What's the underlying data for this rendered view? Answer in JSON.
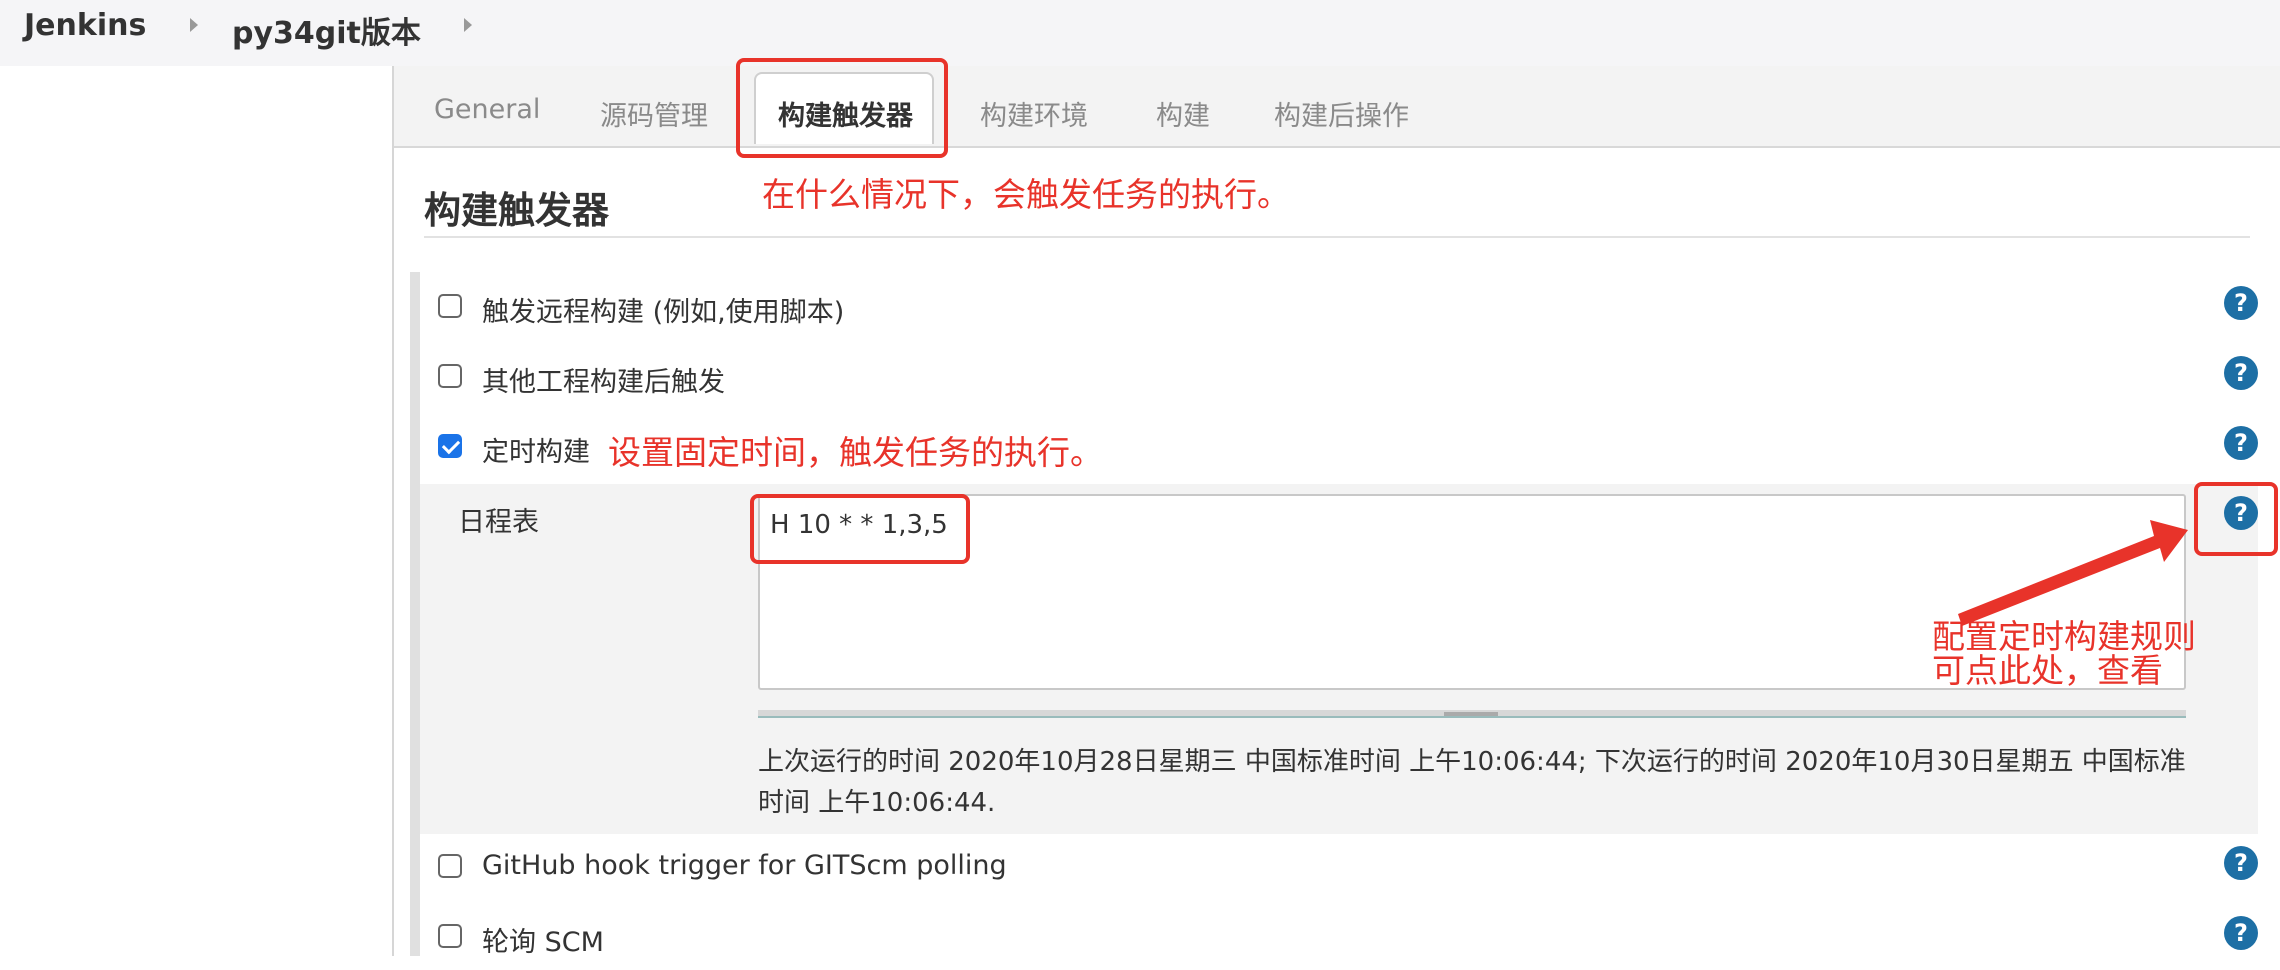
{
  "breadcrumb": {
    "root": "Jenkins",
    "job": "py34git版本"
  },
  "tabs": [
    "General",
    "源码管理",
    "构建触发器",
    "构建环境",
    "构建",
    "构建后操作"
  ],
  "active_tab": "构建触发器",
  "section_title": "构建触发器",
  "triggers": [
    {
      "label": "触发远程构建 (例如,使用脚本)",
      "checked": false
    },
    {
      "label": "其他工程构建后触发",
      "checked": false
    },
    {
      "label": "定时构建",
      "checked": true
    },
    {
      "label": "GitHub hook trigger for GITScm polling",
      "checked": false
    },
    {
      "label": "轮询 SCM",
      "checked": false
    }
  ],
  "schedule": {
    "label": "日程表",
    "value": "H 10 * * 1,3,5",
    "info": "上次运行的时间 2020年10月28日星期三 中国标准时间 上午10:06:44; 下次运行的时间 2020年10月30日星期五 中国标准时间 上午10:06:44."
  },
  "help_glyph": "?",
  "annotations": {
    "tab_note": "在什么情况下，会触发任务的执行。",
    "timer_note": "设置固定时间，触发任务的执行。",
    "help_note_line1": "配置定时构建规则",
    "help_note_line2": "可点此处，查看"
  },
  "colors": {
    "annotation": "#e8332a",
    "help": "#1d6fa5",
    "checkbox": "#1a73e8"
  }
}
